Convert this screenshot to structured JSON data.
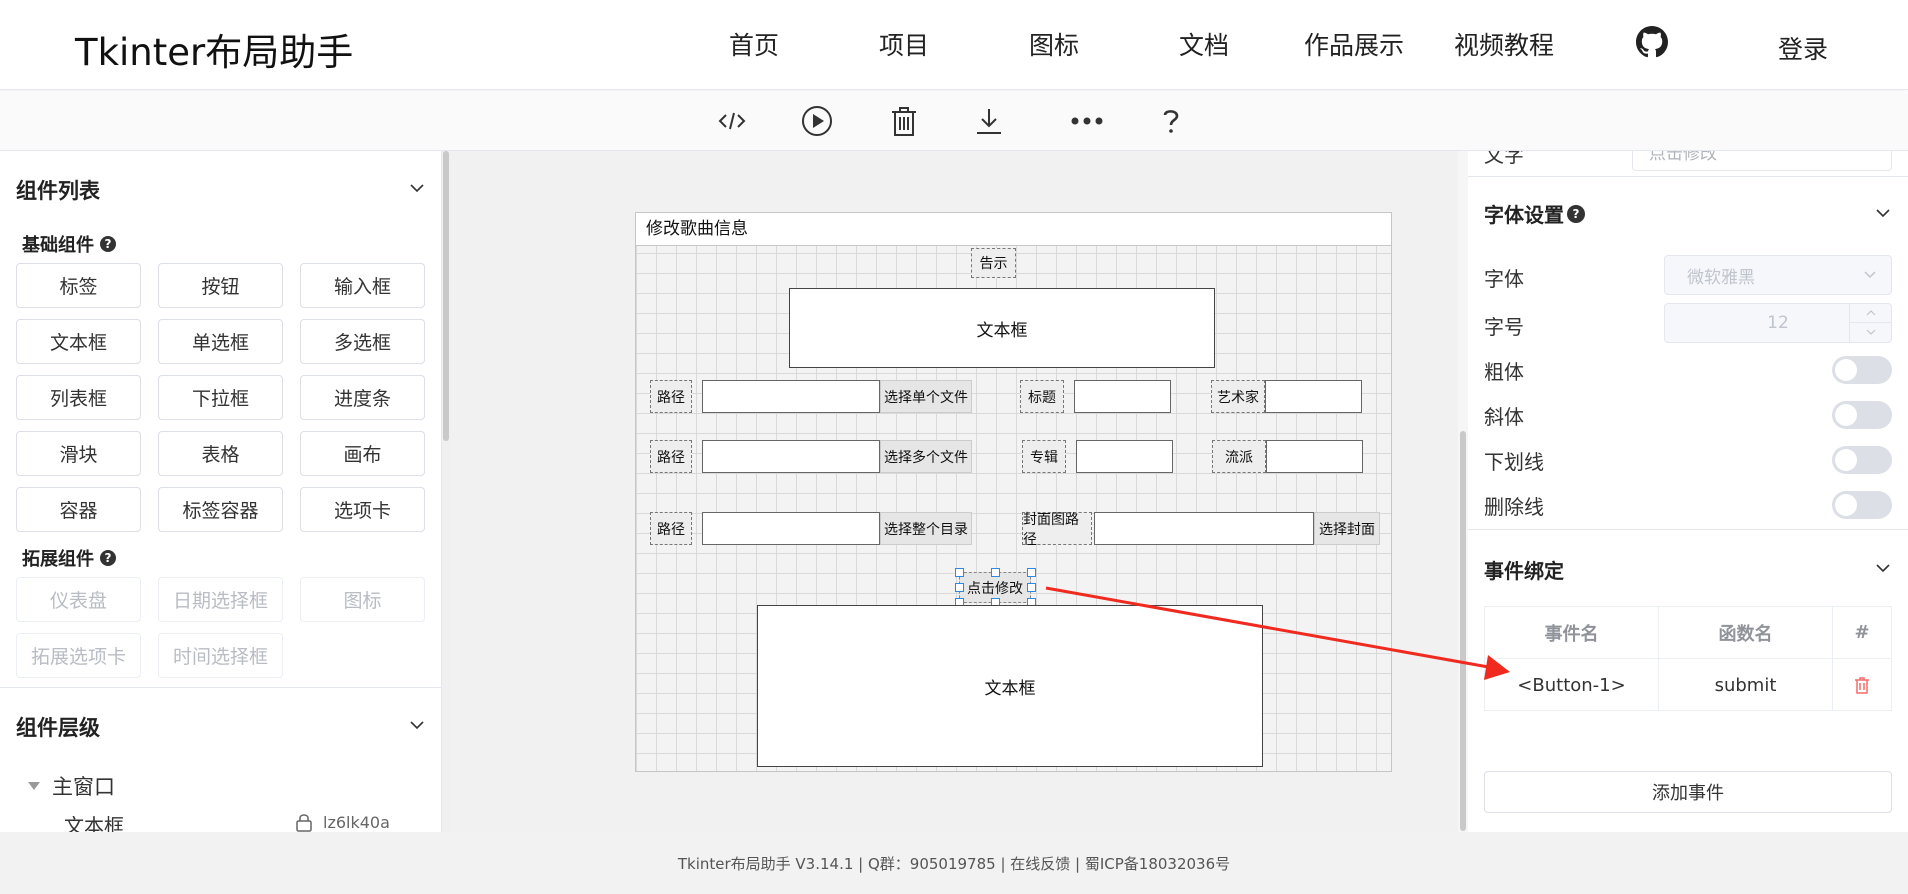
{
  "header": {
    "logo": "Tkinter布局助手",
    "nav": [
      "首页",
      "项目",
      "图标",
      "文档",
      "作品展示",
      "视频教程"
    ],
    "login": "登录"
  },
  "left": {
    "components_title": "组件列表",
    "basic_title": "基础组件",
    "basic": [
      "标签",
      "按钮",
      "输入框",
      "文本框",
      "单选框",
      "多选框",
      "列表框",
      "下拉框",
      "进度条",
      "滑块",
      "表格",
      "画布",
      "容器",
      "标签容器",
      "选项卡"
    ],
    "ext_title": "拓展组件",
    "ext": [
      "仪表盘",
      "日期选择框",
      "图标",
      "拓展选项卡",
      "时间选择框"
    ],
    "layers_title": "组件层级",
    "tree_root": "主窗口",
    "tree_child": "文本框",
    "tree_child_id": "lz6lk40a"
  },
  "canvas": {
    "window_title": "修改歌曲信息",
    "notice": "告示",
    "textbox_top": "文本框",
    "path1": "路径",
    "btn_single": "选择单个文件",
    "title_label": "标题",
    "artist_label": "艺术家",
    "path2": "路径",
    "btn_multi": "选择多个文件",
    "album_label": "专辑",
    "genre_label": "流派",
    "path3": "路径",
    "btn_dir": "选择整个目录",
    "cover_label": "封面图路径",
    "btn_cover": "选择封面",
    "submit": "点击修改",
    "textbox_bottom": "文本框"
  },
  "right": {
    "cut_label": "文字",
    "cut_value": "点击修改",
    "font_title": "字体设置",
    "font_label": "字体",
    "font_value": "微软雅黑",
    "size_label": "字号",
    "size_value": "12",
    "bold": "粗体",
    "italic": "斜体",
    "underline": "下划线",
    "strike": "删除线",
    "event_title": "事件绑定",
    "col_event": "事件名",
    "col_func": "函数名",
    "col_hash": "#",
    "event_name": "<Button-1>",
    "func_name": "submit",
    "add_event": "添加事件"
  },
  "footer": {
    "text": "Tkinter布局助手 V3.14.1 | Q群：905019785 | 在线反馈 | 蜀ICP备18032036号"
  },
  "colors": {
    "arrow": "#f02a1f",
    "handle": "#2b8ae2",
    "delete": "#f56c6c"
  }
}
